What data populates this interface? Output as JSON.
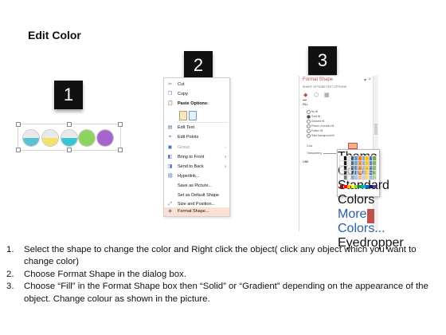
{
  "page_title": "Edit Color",
  "steps": [
    {
      "badge": "1"
    },
    {
      "badge": "2"
    },
    {
      "badge": "3"
    }
  ],
  "circles": [
    {
      "color": "#5bc1d6",
      "full": false
    },
    {
      "color": "#f0e26a",
      "full": false
    },
    {
      "color": "#39c6d3",
      "full": false
    },
    {
      "color": "#8fd25e",
      "full": true
    },
    {
      "color": "#a565cc",
      "full": true
    }
  ],
  "context_menu": {
    "items": [
      {
        "label": "Cut",
        "icon": "scissors-icon"
      },
      {
        "label": "Copy",
        "icon": "copy-icon"
      },
      {
        "label": "Paste Options:",
        "icon": "paste-icon"
      },
      {
        "label": "Edit Text",
        "icon": "edit-text-icon"
      },
      {
        "label": "Edit Points",
        "icon": "edit-points-icon"
      },
      {
        "label": "Group",
        "icon": "group-icon"
      },
      {
        "label": "Bring to Front",
        "icon": "bring-front-icon"
      },
      {
        "label": "Send to Back",
        "icon": "send-back-icon"
      },
      {
        "label": "Hyperlink...",
        "icon": "hyperlink-icon"
      },
      {
        "label": "Save as Picture...",
        "icon": ""
      },
      {
        "label": "Set as Default Shape",
        "icon": ""
      },
      {
        "label": "Size and Position...",
        "icon": "size-position-icon"
      },
      {
        "label": "Format Shape...",
        "icon": "format-shape-icon"
      }
    ]
  },
  "format_pane": {
    "title": "Format Shape",
    "tabs": "SHAPE OPTIONS    TEXT OPTIONS",
    "fill_header": "FILL",
    "fill_options": [
      "No fill",
      "Solid fill",
      "Gradient fill",
      "Picture or texture fill",
      "Pattern fill",
      "Slide background fill"
    ],
    "color_label": "Color",
    "transparency_label": "Transparency",
    "line_header": "LINE",
    "popup": {
      "theme_label": "Theme Colors",
      "standard_label": "Standard Colors",
      "more_colors": "More Colors...",
      "eyedropper": "Eyedropper"
    }
  },
  "instructions": [
    {
      "num": "1.",
      "text": "Select the shape to change the color and Right click the object( click any object which you want to change color)"
    },
    {
      "num": "2.",
      "text": "Choose Format Shape in the dialog box."
    },
    {
      "num": "3.",
      "text": "Choose “Fill” in the Format Shape box then “Solid” or “Gradient” depending on the appearance of the object. Change colour as shown in the picture."
    }
  ]
}
